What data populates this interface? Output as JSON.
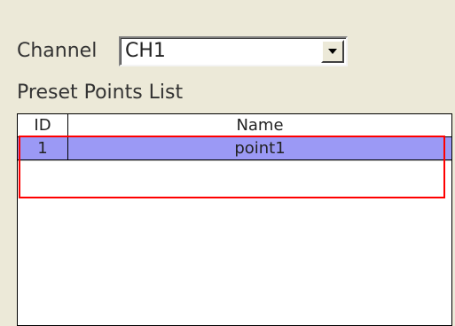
{
  "channel": {
    "label": "Channel",
    "selected_value": "CH1"
  },
  "preset_list": {
    "title": "Preset Points List",
    "columns": [
      "ID",
      "Name"
    ],
    "rows": [
      {
        "id": "1",
        "name": "point1"
      }
    ]
  },
  "icons": {
    "dropdown": "chevron-down-icon"
  },
  "colors": {
    "background": "#ece9d8",
    "selected_row": "#9b99f5",
    "highlight": "#ff0000"
  }
}
